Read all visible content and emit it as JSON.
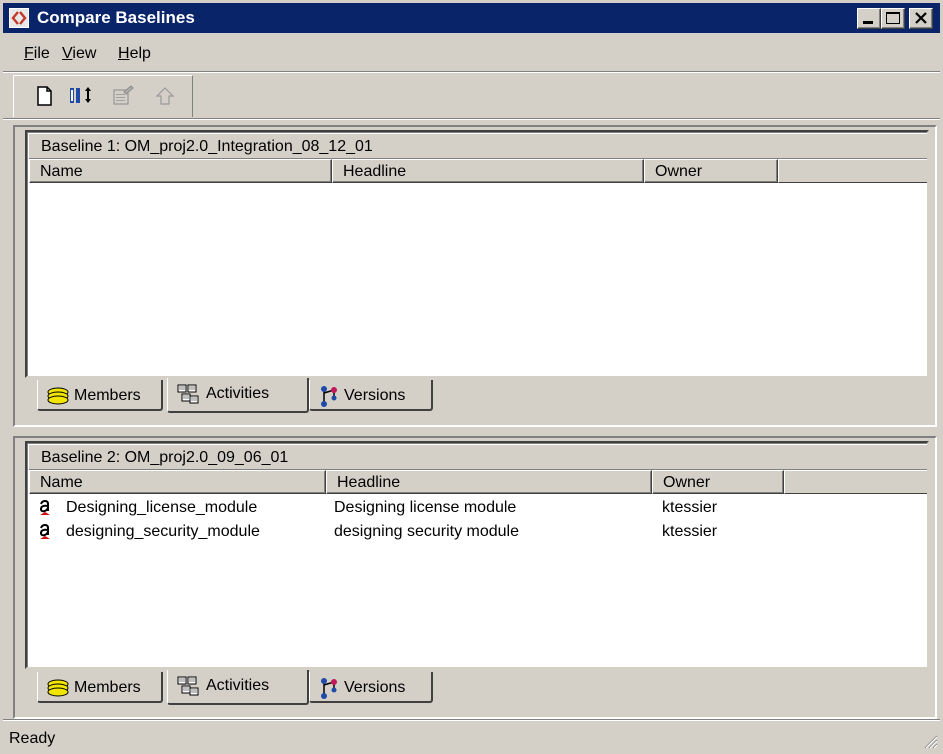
{
  "window": {
    "title": "Compare Baselines"
  },
  "menu": {
    "file": {
      "underline": "F",
      "rest": "ile"
    },
    "view": {
      "underline": "V",
      "rest": "iew"
    },
    "help": {
      "underline": "H",
      "rest": "elp"
    }
  },
  "toolbar": {
    "icons": [
      "new-document-icon",
      "compare-icon",
      "properties-icon",
      "up-arrow-icon"
    ]
  },
  "pane1": {
    "baseline_label": "Baseline 1: OM_proj2.0_Integration_08_12_01",
    "columns": [
      "Name",
      "Headline",
      "Owner"
    ],
    "rows": [],
    "tabs": [
      "Members",
      "Activities",
      "Versions"
    ],
    "active_tab": "Activities"
  },
  "pane2": {
    "baseline_label": "Baseline 2: OM_proj2.0_09_06_01",
    "columns": [
      "Name",
      "Headline",
      "Owner"
    ],
    "rows": [
      {
        "name": "Designing_license_module",
        "headline": "Designing license module",
        "owner": "ktessier"
      },
      {
        "name": "designing_security_module",
        "headline": "designing security module",
        "owner": "ktessier"
      }
    ],
    "tabs": [
      "Members",
      "Activities",
      "Versions"
    ],
    "active_tab": "Activities"
  },
  "status": {
    "text": "Ready"
  },
  "colors": {
    "titlebar": "#0a246a",
    "face": "#d4d0c8",
    "list_bg": "#ffffff"
  }
}
